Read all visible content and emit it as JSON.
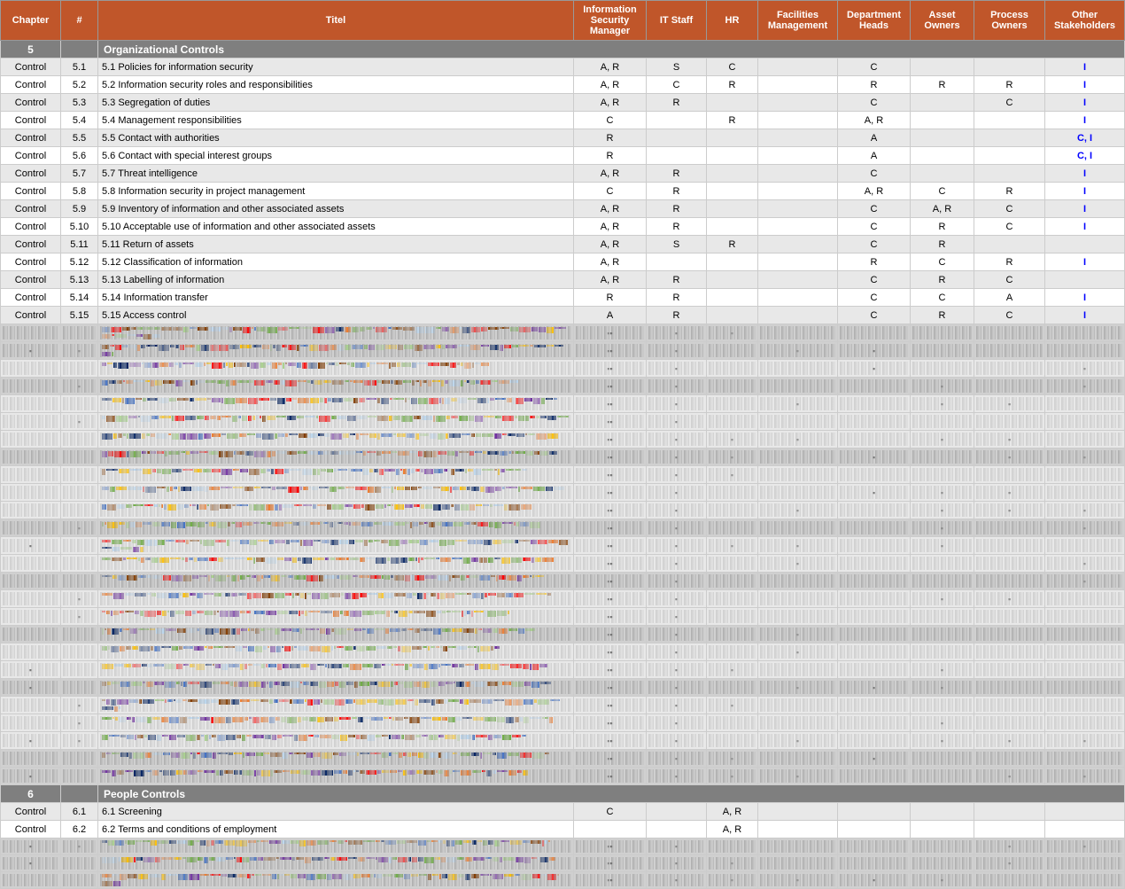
{
  "header": {
    "columns": [
      {
        "key": "chapter",
        "label": "Chapter"
      },
      {
        "key": "num",
        "label": "#"
      },
      {
        "key": "title",
        "label": "Titel"
      },
      {
        "key": "ism",
        "label": "Information Security Manager"
      },
      {
        "key": "itstaff",
        "label": "IT Staff"
      },
      {
        "key": "hr",
        "label": "HR"
      },
      {
        "key": "facilities",
        "label": "Facilities Management"
      },
      {
        "key": "depthead",
        "label": "Department Heads"
      },
      {
        "key": "assetowners",
        "label": "Asset Owners"
      },
      {
        "key": "processowners",
        "label": "Process Owners"
      },
      {
        "key": "other",
        "label": "Other Stakeholders"
      }
    ]
  },
  "section5": {
    "num": "5",
    "label": "Organizational Controls"
  },
  "section6": {
    "num": "6",
    "label": "People Controls"
  },
  "rows5": [
    {
      "chapter": "Control",
      "num": "5.1",
      "title": "5.1 Policies for information security",
      "ism": "A, R",
      "itstaff": "S",
      "hr": "C",
      "facilities": "",
      "depthead": "C",
      "assetowners": "",
      "processowners": "",
      "other": "I"
    },
    {
      "chapter": "Control",
      "num": "5.2",
      "title": "5.2 Information security roles and responsibilities",
      "ism": "A, R",
      "itstaff": "C",
      "hr": "R",
      "facilities": "",
      "depthead": "R",
      "assetowners": "R",
      "processowners": "R",
      "other": "I"
    },
    {
      "chapter": "Control",
      "num": "5.3",
      "title": "5.3 Segregation of duties",
      "ism": "A, R",
      "itstaff": "R",
      "hr": "",
      "facilities": "",
      "depthead": "C",
      "assetowners": "",
      "processowners": "C",
      "other": "I"
    },
    {
      "chapter": "Control",
      "num": "5.4",
      "title": "5.4 Management responsibilities",
      "ism": "C",
      "itstaff": "",
      "hr": "R",
      "facilities": "",
      "depthead": "A, R",
      "assetowners": "",
      "processowners": "",
      "other": "I"
    },
    {
      "chapter": "Control",
      "num": "5.5",
      "title": "5.5 Contact with authorities",
      "ism": "R",
      "itstaff": "",
      "hr": "",
      "facilities": "",
      "depthead": "A",
      "assetowners": "",
      "processowners": "",
      "other": "C, I"
    },
    {
      "chapter": "Control",
      "num": "5.6",
      "title": "5.6 Contact with special interest groups",
      "ism": "R",
      "itstaff": "",
      "hr": "",
      "facilities": "",
      "depthead": "A",
      "assetowners": "",
      "processowners": "",
      "other": "C, I"
    },
    {
      "chapter": "Control",
      "num": "5.7",
      "title": "5.7 Threat intelligence",
      "ism": "A, R",
      "itstaff": "R",
      "hr": "",
      "facilities": "",
      "depthead": "C",
      "assetowners": "",
      "processowners": "",
      "other": "I"
    },
    {
      "chapter": "Control",
      "num": "5.8",
      "title": "5.8 Information security in project management",
      "ism": "C",
      "itstaff": "R",
      "hr": "",
      "facilities": "",
      "depthead": "A, R",
      "assetowners": "C",
      "processowners": "R",
      "other": "I"
    },
    {
      "chapter": "Control",
      "num": "5.9",
      "title": "5.9 Inventory of information and other associated assets",
      "ism": "A, R",
      "itstaff": "R",
      "hr": "",
      "facilities": "",
      "depthead": "C",
      "assetowners": "A, R",
      "processowners": "C",
      "other": "I"
    },
    {
      "chapter": "Control",
      "num": "5.10",
      "title": "5.10 Acceptable use of information and other associated assets",
      "ism": "A, R",
      "itstaff": "R",
      "hr": "",
      "facilities": "",
      "depthead": "C",
      "assetowners": "R",
      "processowners": "C",
      "other": "I"
    },
    {
      "chapter": "Control",
      "num": "5.11",
      "title": "5.11 Return of assets",
      "ism": "A, R",
      "itstaff": "S",
      "hr": "R",
      "facilities": "",
      "depthead": "C",
      "assetowners": "R",
      "processowners": "",
      "other": ""
    },
    {
      "chapter": "Control",
      "num": "5.12",
      "title": "5.12 Classification of information",
      "ism": "A, R",
      "itstaff": "",
      "hr": "",
      "facilities": "",
      "depthead": "R",
      "assetowners": "C",
      "processowners": "R",
      "other": "I"
    },
    {
      "chapter": "Control",
      "num": "5.13",
      "title": "5.13 Labelling of information",
      "ism": "A, R",
      "itstaff": "R",
      "hr": "",
      "facilities": "",
      "depthead": "C",
      "assetowners": "R",
      "processowners": "C",
      "other": ""
    },
    {
      "chapter": "Control",
      "num": "5.14",
      "title": "5.14 Information transfer",
      "ism": "R",
      "itstaff": "R",
      "hr": "",
      "facilities": "",
      "depthead": "C",
      "assetowners": "C",
      "processowners": "A",
      "other": "I"
    },
    {
      "chapter": "Control",
      "num": "5.15",
      "title": "5.15 Access control",
      "ism": "A",
      "itstaff": "R",
      "hr": "",
      "facilities": "",
      "depthead": "C",
      "assetowners": "R",
      "processowners": "C",
      "other": "I"
    }
  ],
  "rows6": [
    {
      "chapter": "Control",
      "num": "6.1",
      "title": "6.1 Screening",
      "ism": "C",
      "itstaff": "",
      "hr": "A, R",
      "facilities": "",
      "depthead": "",
      "assetowners": "",
      "processowners": "",
      "other": ""
    },
    {
      "chapter": "Control",
      "num": "6.2",
      "title": "6.2 Terms and conditions of employment",
      "ism": "",
      "itstaff": "",
      "hr": "A, R",
      "facilities": "",
      "depthead": "",
      "assetowners": "",
      "processowners": "",
      "other": ""
    }
  ]
}
